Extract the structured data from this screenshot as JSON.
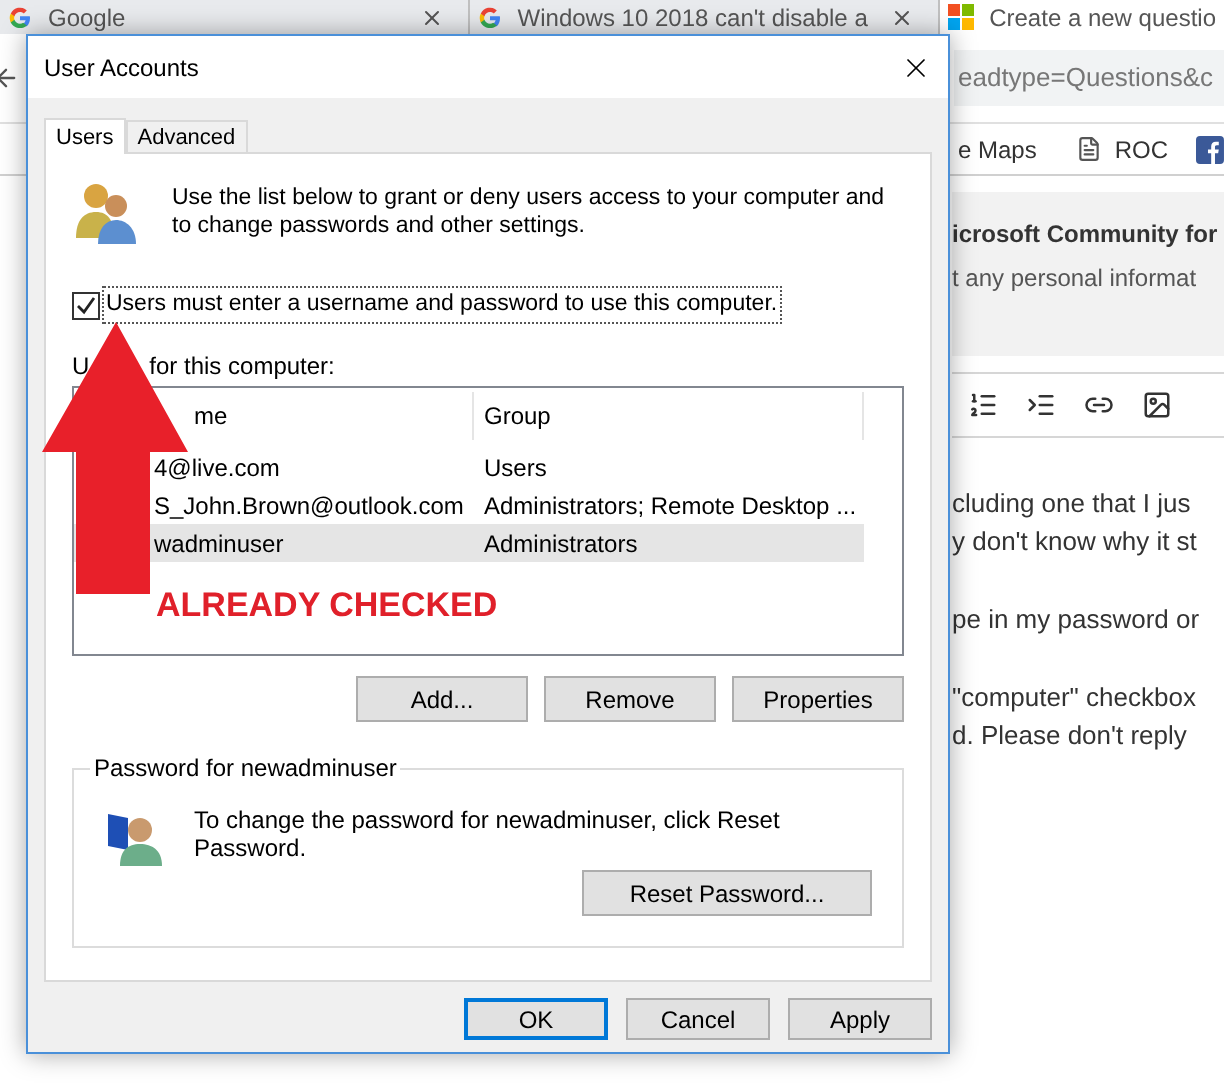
{
  "browser": {
    "tabs": [
      {
        "title": "Google",
        "selected": false
      },
      {
        "title": "Windows 10 2018 can't disable a",
        "selected": false
      },
      {
        "title": "Create a new questio",
        "selected": true
      }
    ],
    "address": "eadtype=Questions&c",
    "bookmarks": [
      "e Maps",
      "ROC"
    ],
    "page": {
      "heading": "icrosoft Community for",
      "subheading": "t any personal informat",
      "paragraphs": [
        [
          "cluding one that I jus",
          "y don't know why it st"
        ],
        [
          "pe in my password or"
        ],
        [
          "\"computer\" checkbox",
          "d. Please don't reply"
        ]
      ]
    }
  },
  "dialog": {
    "title": "User Accounts",
    "tabs": [
      {
        "label": "Users",
        "selected": true
      },
      {
        "label": "Advanced",
        "selected": false
      }
    ],
    "intro": "Use the list below to grant or deny users access to your computer and to change passwords and other settings.",
    "require_login": {
      "label": "Users must enter a username and password to use this computer.",
      "checked": true
    },
    "users_label_parts": [
      "U",
      "for this computer:"
    ],
    "user_list": {
      "columns": [
        "me",
        "Group"
      ],
      "rows": [
        {
          "name": "4@live.com",
          "group": "Users",
          "selected": false
        },
        {
          "name": "S_John.Brown@outlook.com",
          "group": "Administrators; Remote Desktop ...",
          "selected": false
        },
        {
          "name": "wadminuser",
          "group": "Administrators",
          "selected": true
        }
      ]
    },
    "list_buttons": [
      "Add...",
      "Remove",
      "Properties"
    ],
    "password_group": {
      "title": "Password for newadminuser",
      "text": "To change the password for newadminuser, click Reset Password.",
      "button": "Reset Password..."
    },
    "footer_buttons": [
      {
        "label": "OK",
        "default": true
      },
      {
        "label": "Cancel",
        "default": false
      },
      {
        "label": "Apply",
        "default": false
      }
    ]
  },
  "annotation": {
    "text": "ALREADY CHECKED"
  }
}
